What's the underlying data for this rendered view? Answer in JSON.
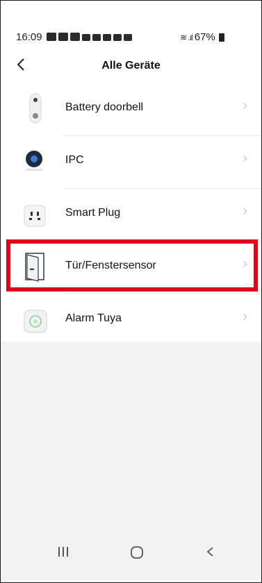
{
  "status": {
    "time": "16:09",
    "battery": "67%"
  },
  "header": {
    "title": "Alle Geräte"
  },
  "devices": [
    {
      "label": "Battery doorbell"
    },
    {
      "label": "IPC"
    },
    {
      "label": "Smart Plug"
    },
    {
      "label": "Tür/Fenstersensor"
    },
    {
      "label": "Alarm Tuya"
    }
  ],
  "colors": {
    "highlight": "#e0001b",
    "chevron": "#c8c8c8"
  },
  "icons": {
    "back": "chevron-left-icon",
    "row_chevron": "chevron-right-icon",
    "nav_recent": "recent-apps-icon",
    "nav_home": "home-icon",
    "nav_back": "back-icon"
  }
}
